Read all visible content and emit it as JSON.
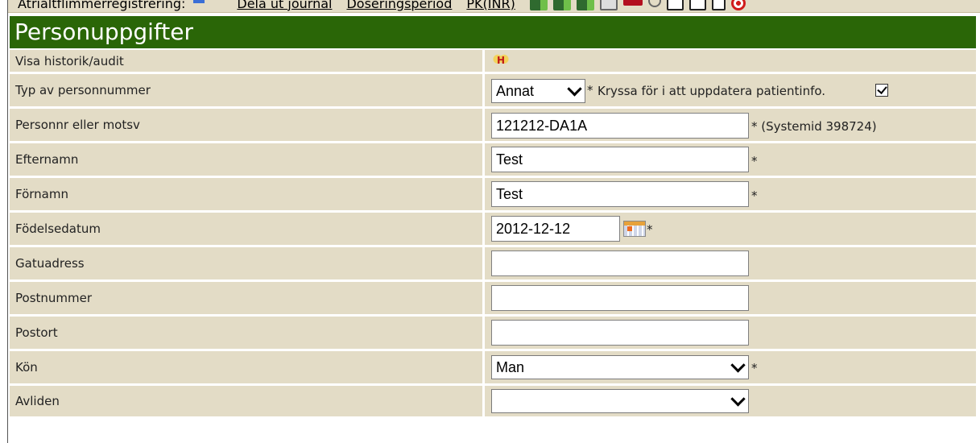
{
  "toolbar": {
    "label": "Atrialtflimmerregistrering:",
    "links": [
      "Dela ut journal",
      "Doseringsperiod",
      "PK(INR)"
    ],
    "icons": [
      "save-green-icon",
      "export-green-icon",
      "save-globe-icon",
      "mail-image-icon",
      "red-shape-icon",
      "magnifier-icon",
      "envelope-icon",
      "envelope-icon",
      "checkbox-icon",
      "target-icon"
    ]
  },
  "header": {
    "title": "Personuppgifter"
  },
  "rows": {
    "history": {
      "label": "Visa historik/audit",
      "icon": "history-icon",
      "icon_text": "H"
    },
    "type": {
      "label": "Typ av personnummer",
      "value": "Annat",
      "required": "*",
      "note": "Kryssa för i att uppdatera patientinfo.",
      "checked": true
    },
    "pnr": {
      "label": "Personnr eller motsv",
      "value": "121212-DA1A",
      "note": "* (Systemid 398724)"
    },
    "lastname": {
      "label": "Efternamn",
      "value": "Test",
      "required": "*"
    },
    "firstname": {
      "label": "Förnamn",
      "value": "Test",
      "required": "*"
    },
    "birthdate": {
      "label": "Födelsedatum",
      "value": "2012-12-12",
      "required": "*"
    },
    "street": {
      "label": "Gatuadress",
      "value": ""
    },
    "zip": {
      "label": "Postnummer",
      "value": ""
    },
    "city": {
      "label": "Postort",
      "value": ""
    },
    "gender": {
      "label": "Kön",
      "value": "Man",
      "required": "*"
    },
    "deceased": {
      "label": "Avliden",
      "value": ""
    }
  },
  "colors": {
    "header_bg": "#2a6607",
    "row_bg": "#e3dcc6",
    "header_text": "#ffffff"
  }
}
